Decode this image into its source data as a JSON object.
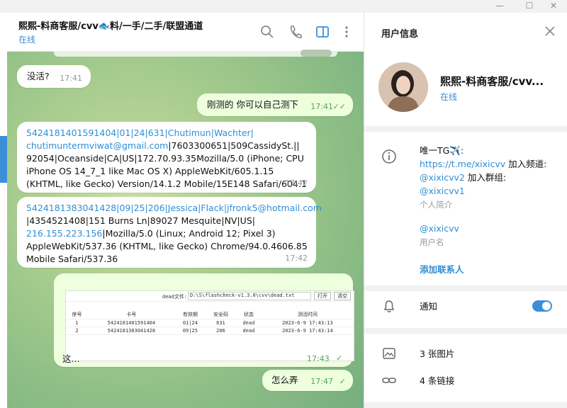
{
  "window": {
    "minimize_glyph": "—",
    "maximize_glyph": "☐"
  },
  "chat": {
    "title": "熙熙-料商客服/cvv🐟料/一手/二手/联盟通道",
    "status": "在线",
    "messages": [
      {
        "dir": "in",
        "text": "没活?",
        "time": "17:41"
      },
      {
        "dir": "out",
        "text": "刚测的 你可以自己测下",
        "time": "17:41"
      },
      {
        "dir": "in",
        "time": "17:42",
        "parts": [
          "5424181401591404|01|24|631|Chutimun|Wachter|",
          "chutimuntermviwat@gmail.com",
          "|7603300651|509CassidySt.||",
          "92054|Oceanside|CA|US|172.70.93.35Mozilla/5.0 (iPhone; CPU iPhone OS 14_7_1 like Mac OS X) AppleWebKit/605.1.15 (KHTML, like Gecko) Version/14.1.2 Mobile/15E148 Safari/604.1"
        ]
      },
      {
        "dir": "in",
        "time": "17:42",
        "parts": [
          "5424181383041428|09|25|206|Jessica|Flack|jfronk5@hotmail.com",
          "|4354521408|151 Burns Ln|89027 Mesquite|NV|US|",
          "216.155.223.156",
          "|Mozilla/5.0 (Linux; Android 12; Pixel 3) AppleWebKit/537.36 (KHTML, like Gecko) Chrome/94.0.4606.85 Mobile Safari/537.36"
        ]
      },
      {
        "dir": "out",
        "text": "这...",
        "time": "17:43"
      },
      {
        "dir": "out",
        "text": "怎么弄",
        "time": "17:47"
      }
    ],
    "screenshot": {
      "file_label": "dead文件:",
      "file_path": "D:\\S\\flashcheck-v1.3.0\\cvv\\dead.txt",
      "open_btn": "打开",
      "clear_btn": "清空",
      "columns": [
        "序号",
        "卡号",
        "有效期",
        "安全码",
        "状态",
        "测活时间"
      ],
      "rows": [
        [
          "1",
          "5424181401591404",
          "01|24",
          "631",
          "dead",
          "2023-6-9 17:43:13"
        ],
        [
          "2",
          "5424181383041428",
          "09|25",
          "206",
          "dead",
          "2023-6-9 17:43:14"
        ]
      ]
    }
  },
  "info": {
    "title": "用户信息",
    "name": "熙熙-料商客服/cvv...",
    "status": "在线",
    "bio_line1": "唯一TG✈️:",
    "bio_link1": "https://t.me/xixicvv",
    "bio_mid1": " 加入频道:",
    "bio_link2": "@xixicvv2",
    "bio_mid2": " 加入群组:",
    "bio_link3": "@xixicvv1",
    "bio_caption": "个人简介",
    "username": "@xixicvv",
    "username_caption": "用户名",
    "add_contact": "添加联系人",
    "notify_label": "通知",
    "notify_on": true,
    "photos": "3 张图片",
    "links": "4 条链接"
  },
  "colors": {
    "accent": "#3a8fd8",
    "outgoing": "#eeffde",
    "incoming": "#ffffff"
  }
}
